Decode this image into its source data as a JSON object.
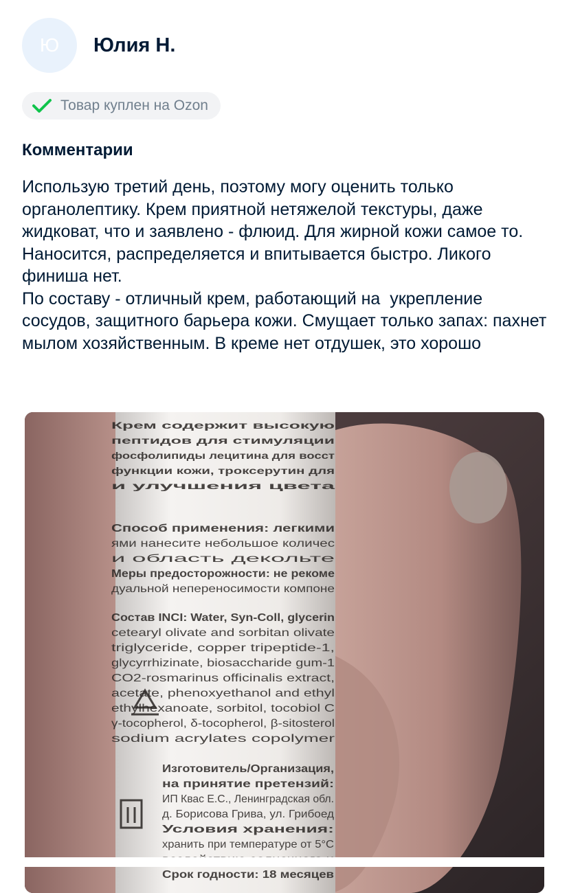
{
  "review": {
    "avatar_letter": "Ю",
    "author": "Юлия Н.",
    "verified_badge": "Товар куплен на Ozon",
    "comments_title": "Комментарии",
    "comment_text": "Использую третий день, поэтому могу оценить только органолептику. Крем приятной нетяжелой текстуры, даже жидковат, что и заявлено - флюид. Для жирной кожи самое то. Наносится, распределяется и впитывается быстро. Ликого финиша нет.\nПо составу - отличный крем, работающий на  укрепление сосудов, защитного барьера кожи. Смущает только запах: пахнет мылом хозяйственным. В креме нет отдушек, это хорошо"
  },
  "photo": {
    "label_lines": [
      "Крем содержит высокую",
      "пептидов для стимуляции",
      "фосфолипиды лецитина для восст",
      "функции кожи, троксерутин для",
      "и улучшения цвета",
      "Способ применения: легкими",
      "ями нанесите небольшое количес",
      "и область декольте",
      "Меры предосторожности: не рекоме",
      "дуальной непереносимости компоне",
      "Состав INCI: Water, Syn-Coll, glycerin",
      "cetearyl olivate and sorbitan olivate",
      "triglyceride, copper tripeptide-1,",
      "glycyrrhizinate, biosaccharide gum-1",
      "CO2-rosmarinus officinalis extract,",
      "acetate, phenoxyethanol and ethyl",
      "ethylhexanoate, sorbitol, tocobiol C",
      "γ-tocopherol, δ-tocopherol, β-sitosterol",
      "sodium acrylates copolymer",
      "Изготовитель/Организация,",
      "на принятие претензий:",
      "ИП Квас Е.С., Ленинградская обл.",
      "д. Борисова Грива, ул. Грибоед",
      "Условия хранения:",
      "хранить при температуре от 5°C",
      "воздействию солнечного и",
      "Срок годности: 18 месяцев"
    ]
  },
  "colors": {
    "text": "#001a34",
    "muted": "#707f8d",
    "badge_bg": "#f2f3f5",
    "check": "#10c44c",
    "avatar_bg": "#e9f2fc"
  }
}
